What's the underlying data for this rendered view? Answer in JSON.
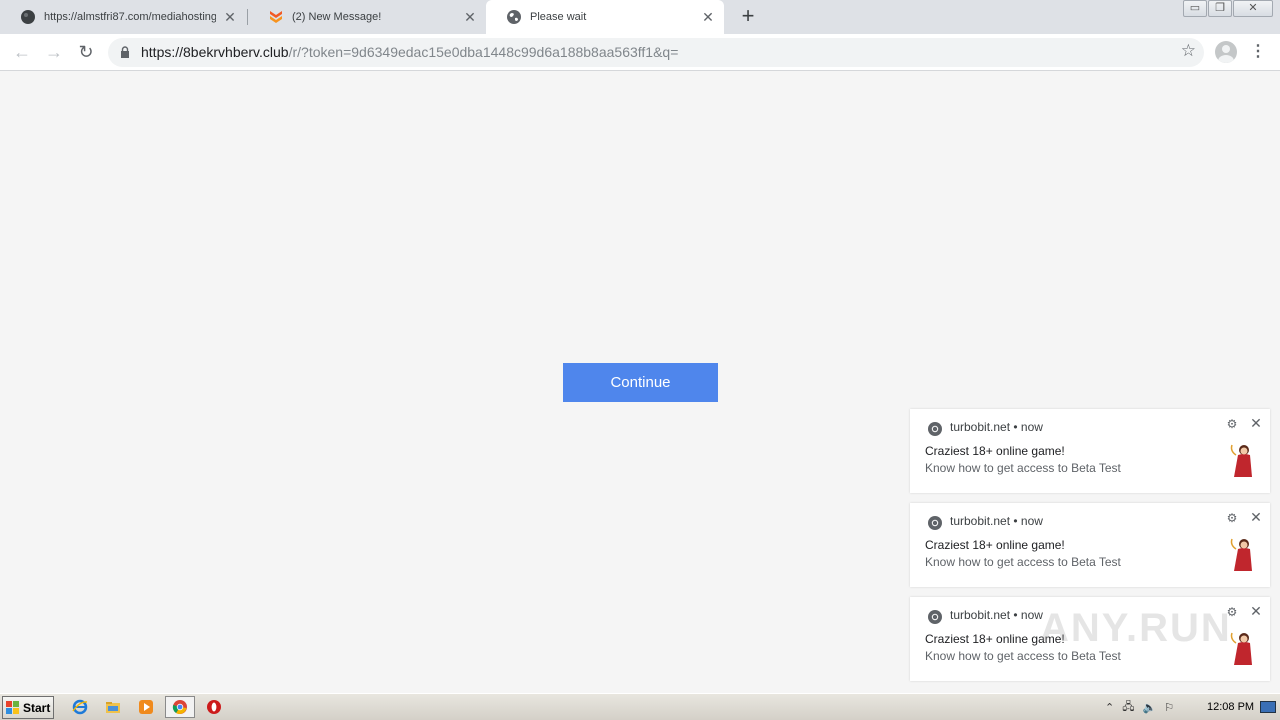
{
  "browser": {
    "tabs": [
      {
        "title": "https://almstfri87.com/mediahosting",
        "icon": "globe-dark-icon",
        "active": false
      },
      {
        "title": "(2) New Message!",
        "icon": "stack-orange-icon",
        "active": false
      },
      {
        "title": "Please wait",
        "icon": "globe-icon",
        "active": true
      }
    ],
    "new_tab_label": "+",
    "window_controls": {
      "minimize": "▭",
      "restore": "❐",
      "close": "✕"
    },
    "address": {
      "host": "https://8bekrvhberv.club",
      "path": "/r/?token=9d6349edac15e0dba1448c99d6a188b8aa563ff1&q="
    }
  },
  "page": {
    "continue_label": "Continue",
    "accent_color": "#4f86ec"
  },
  "notifications": [
    {
      "source": "turbobit.net • now",
      "title": "Craziest 18+ online game!",
      "body": "Know how to get access to Beta Test"
    },
    {
      "source": "turbobit.net • now",
      "title": "Craziest 18+ online game!",
      "body": "Know how to get access to Beta Test"
    },
    {
      "source": "turbobit.net • now",
      "title": "Craziest 18+ online game!",
      "body": "Know how to get access to Beta Test"
    }
  ],
  "watermark": "ANY.RUN",
  "taskbar": {
    "start_label": "Start",
    "apps": [
      "ie-icon",
      "explorer-icon",
      "media-player-icon",
      "chrome-icon",
      "opera-icon"
    ],
    "clock": "12:08 PM"
  }
}
